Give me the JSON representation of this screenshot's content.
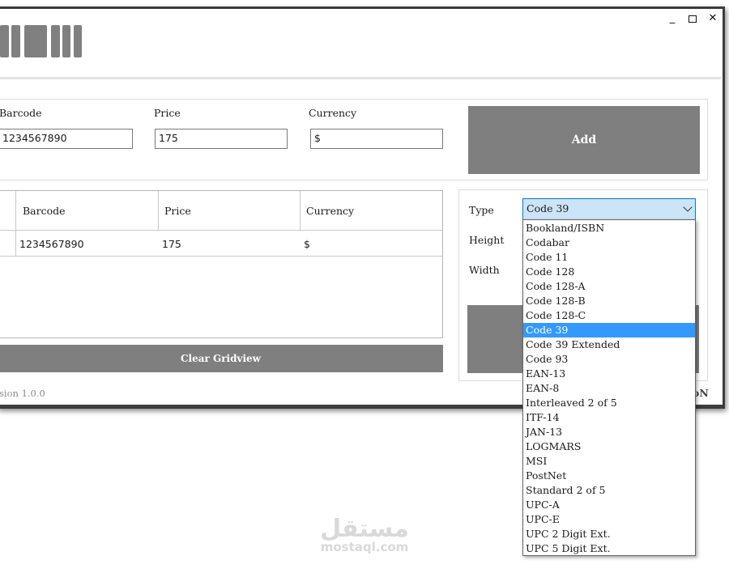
{
  "window": {
    "controls": {
      "minimize": "_",
      "maximize": "☐",
      "close": "✕"
    }
  },
  "entry": {
    "barcode_label": "Barcode",
    "barcode_value": "1234567890",
    "price_label": "Price",
    "price_value": "175",
    "currency_label": "Currency",
    "currency_value": "$",
    "add_label": "Add"
  },
  "grid": {
    "columns": [
      "Barcode",
      "Price",
      "Currency"
    ],
    "rows": [
      {
        "barcode": "1234567890",
        "price": "175",
        "currency": "$"
      }
    ],
    "clear_label": "Clear Gridview"
  },
  "settings": {
    "type_label": "Type",
    "height_label": "Height",
    "width_label": "Width",
    "type_selected": "Code 39",
    "type_options": [
      "Bookland/ISBN",
      "Codabar",
      "Code 11",
      "Code 128",
      "Code 128-A",
      "Code 128-B",
      "Code 128-C",
      "Code 39",
      "Code 39 Extended",
      "Code 93",
      "EAN-13",
      "EAN-8",
      "Interleaved 2 of 5",
      "ITF-14",
      "JAN-13",
      "LOGMARS",
      "MSI",
      "PostNet",
      "Standard 2 of 5",
      "UPC-A",
      "UPC-E",
      "UPC 2 Digit Ext.",
      "UPC 5 Digit Ext."
    ]
  },
  "footer": {
    "version": "sion 1.0.0",
    "right_text": "oN"
  },
  "watermark": {
    "arabic": "مستقل",
    "latin": "mostaql.com"
  },
  "colors": {
    "button_gray": "#7f7f7f",
    "selection_blue": "#3399ff",
    "combo_bg": "#cce4f7"
  }
}
